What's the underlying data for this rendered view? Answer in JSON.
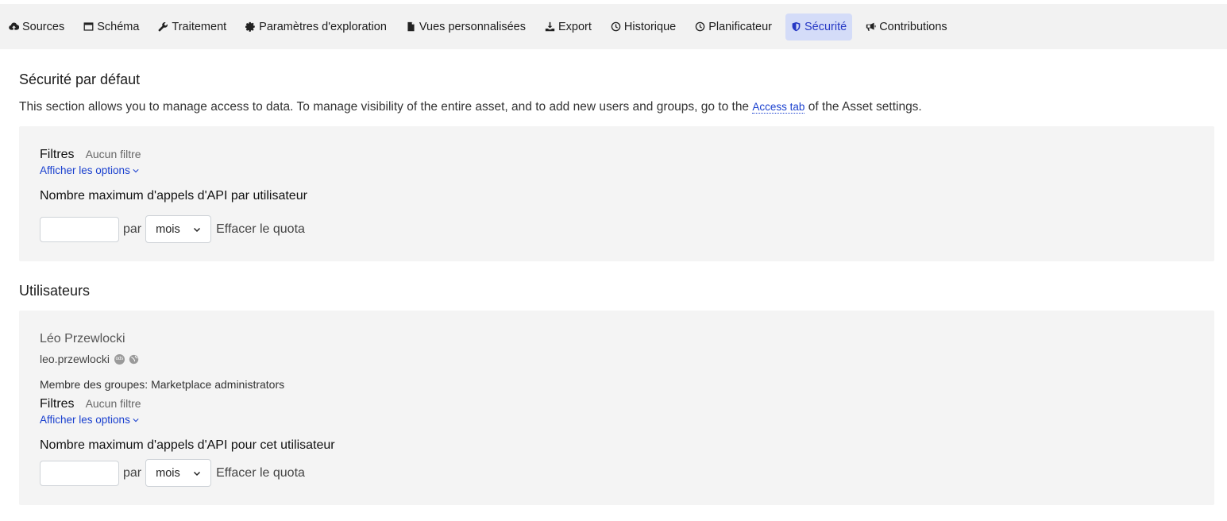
{
  "tabs": [
    {
      "label": "Sources",
      "icon": "cloud-upload-icon",
      "active": false
    },
    {
      "label": "Schéma",
      "icon": "window-icon",
      "active": false
    },
    {
      "label": "Traitement",
      "icon": "wrench-icon",
      "active": false
    },
    {
      "label": "Paramètres d'exploration",
      "icon": "gear-icon",
      "active": false
    },
    {
      "label": "Vues personnalisées",
      "icon": "file-icon",
      "active": false
    },
    {
      "label": "Export",
      "icon": "download-icon",
      "active": false
    },
    {
      "label": "Historique",
      "icon": "clock-icon",
      "active": false
    },
    {
      "label": "Planificateur",
      "icon": "clock-icon",
      "active": false
    },
    {
      "label": "Sécurité",
      "icon": "shield-icon",
      "active": true
    },
    {
      "label": "Contributions",
      "icon": "megaphone-icon",
      "active": false
    }
  ],
  "default_security": {
    "title": "Sécurité par défaut",
    "intro_before": "This section allows you to manage access to data. To manage visibility of the entire asset, and to add new users and groups, go to the ",
    "intro_link": "Access tab",
    "intro_after": " of the Asset settings.",
    "filters_label": "Filtres",
    "filters_value": "Aucun filtre",
    "show_options": "Afficher les options",
    "quota_label": "Nombre maximum d'appels d'API par utilisateur",
    "quota_value": "",
    "per_label": "par",
    "period": "mois",
    "clear_quota": "Effacer le quota"
  },
  "users": {
    "title": "Utilisateurs",
    "user": {
      "name": "Léo Przewlocki",
      "login": "leo.przewlocki",
      "badge_text": "ods",
      "member_of": "Membre des groupes: Marketplace administrators",
      "filters_label": "Filtres",
      "filters_value": "Aucun filtre",
      "show_options": "Afficher les options",
      "quota_label": "Nombre maximum d'appels d'API pour cet utilisateur",
      "quota_value": "",
      "per_label": "par",
      "period": "mois",
      "clear_quota": "Effacer le quota"
    }
  },
  "colors": {
    "accent": "#1a40cf",
    "active_tab_bg": "#d4dcf8",
    "panel_bg": "#f4f4f4",
    "tabbar_bg": "#f2f2f2"
  }
}
